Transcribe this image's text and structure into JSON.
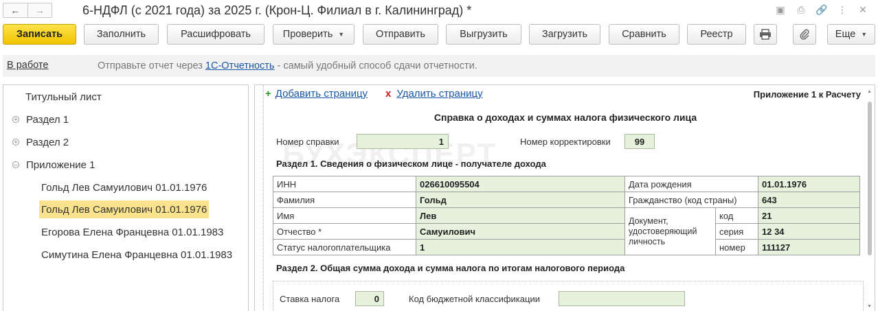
{
  "window": {
    "title": "6-НДФЛ (с 2021 года) за 2025 г. (Крон-Ц. Филиал в г. Калининград) *",
    "back_glyph": "🡐",
    "forward_glyph": "🡒"
  },
  "toolbar": {
    "save": "Записать",
    "fill": "Заполнить",
    "decode": "Расшифровать",
    "check": "Проверить",
    "send": "Отправить",
    "export": "Выгрузить",
    "import": "Загрузить",
    "compare": "Сравнить",
    "registry": "Реестр",
    "more": "Еще"
  },
  "infobar": {
    "status": "В работе",
    "text_before": "Отправьте отчет через ",
    "link": "1С-Отчетность",
    "text_after": " - самый удобный способ сдачи отчетности."
  },
  "tree": {
    "title_sheet": "Титульный лист",
    "section1": "Раздел 1",
    "section2": "Раздел 2",
    "appendix1": "Приложение 1",
    "people": [
      "Гольд Лев Самуилович 01.01.1976",
      "Гольд Лев Самуилович 01.01.1976",
      "Егорова Елена Францевна 01.01.1983",
      "Симутина Елена Францевна 01.01.1983"
    ]
  },
  "form": {
    "add_page": "Добавить страницу",
    "delete_page": "Удалить страницу",
    "appendix_label": "Приложение 1 к Расчету",
    "watermark": "БУХЭКСПЕРТ",
    "heading": "Справка о доходах и суммах налога физического лица",
    "cert_no_label": "Номер справки",
    "cert_no": "1",
    "correction_label": "Номер корректировки",
    "correction": "99",
    "section1_title": "Раздел 1. Сведения о физическом лице - получателе дохода",
    "inn_label": "ИНН",
    "inn": "026610095504",
    "surname_label": "Фамилия",
    "surname": "Гольд",
    "name_label": "Имя",
    "name": "Лев",
    "patronymic_label": "Отчество *",
    "patronymic": "Самуилович",
    "taxpayer_status_label": "Статус налогоплательщика",
    "taxpayer_status": "1",
    "birth_label": "Дата рождения",
    "birth": "01.01.1976",
    "citizenship_label": "Гражданство (код страны)",
    "citizenship": "643",
    "document_label": "Документ, удостоверяющий личность",
    "doc_code_label": "код",
    "doc_code": "21",
    "doc_series_label": "серия",
    "doc_series": "12 34",
    "doc_number_label": "номер",
    "doc_number": "111127",
    "section2_title": "Раздел 2. Общая сумма дохода и сумма налога по итогам налогового периода",
    "tax_rate_label": "Ставка налога",
    "tax_rate": "0",
    "kbk_label": "Код бюджетной классификации",
    "kbk": ""
  },
  "colors": {
    "primary_button": "#f2c400",
    "selected_item": "#fbe38e",
    "field_bg": "#e6f2de",
    "link": "#1a57a6"
  }
}
